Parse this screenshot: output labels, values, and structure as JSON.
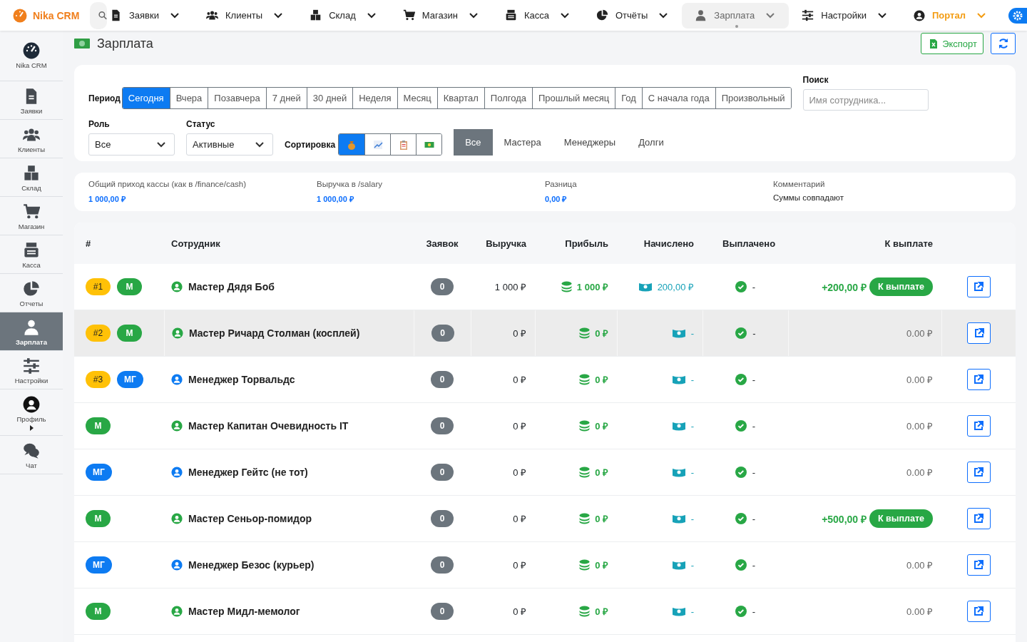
{
  "topbar": {
    "brand": "Nika CRM",
    "nav": [
      {
        "label": "Заявки",
        "selected": false
      },
      {
        "label": "Клиенты",
        "selected": false
      },
      {
        "label": "Склад",
        "selected": false
      },
      {
        "label": "Магазин",
        "selected": false
      },
      {
        "label": "Касса",
        "selected": false
      },
      {
        "label": "Отчёты",
        "selected": false
      },
      {
        "label": "Зарплата",
        "selected": true
      },
      {
        "label": "Настройки",
        "selected": false
      },
      {
        "label": "Портал",
        "selected": false
      }
    ]
  },
  "sidebar": {
    "items": [
      {
        "label": "Nika CRM",
        "selected": false
      },
      {
        "label": "Заявки",
        "selected": false
      },
      {
        "label": "Клиенты",
        "selected": false
      },
      {
        "label": "Склад",
        "selected": false
      },
      {
        "label": "Магазин",
        "selected": false
      },
      {
        "label": "Касса",
        "selected": false
      },
      {
        "label": "Отчеты",
        "selected": false
      },
      {
        "label": "Зарплата",
        "selected": true
      },
      {
        "label": "Настройки",
        "selected": false
      },
      {
        "label": "Профиль",
        "selected": false
      },
      {
        "label": "Чат",
        "selected": false
      }
    ]
  },
  "page": {
    "title": "Зарплата",
    "export_button": "Экспорт"
  },
  "filters": {
    "period_label": "Период",
    "periods": [
      {
        "label": "Сегодня",
        "selected": true
      },
      {
        "label": "Вчера",
        "selected": false
      },
      {
        "label": "Позавчера",
        "selected": false
      },
      {
        "label": "7 дней",
        "selected": false
      },
      {
        "label": "30 дней",
        "selected": false
      },
      {
        "label": "Неделя",
        "selected": false
      },
      {
        "label": "Месяц",
        "selected": false
      },
      {
        "label": "Квартал",
        "selected": false
      },
      {
        "label": "Полгода",
        "selected": false
      },
      {
        "label": "Прошлый месяц",
        "selected": false
      },
      {
        "label": "Год",
        "selected": false
      },
      {
        "label": "С начала года",
        "selected": false
      },
      {
        "label": "Произвольный",
        "selected": false
      }
    ],
    "search_label": "Поиск",
    "search": {
      "placeholder": "Имя сотрудника..."
    },
    "role_label": "Роль",
    "role_value": "Все",
    "status_label": "Статус",
    "status_value": "Активные",
    "sort_label": "Сортировка",
    "sort_options": [
      {
        "selected": true
      },
      {
        "selected": false
      },
      {
        "selected": false
      },
      {
        "selected": false
      }
    ],
    "groups": [
      {
        "label": "Все",
        "selected": true
      },
      {
        "label": "Мастера",
        "selected": false
      },
      {
        "label": "Менеджеры",
        "selected": false
      },
      {
        "label": "Долги",
        "selected": false
      }
    ]
  },
  "summary": [
    {
      "label": "Общий приход кассы (как в /finance/cash)",
      "value": "1 000,00 ₽",
      "kind": "money"
    },
    {
      "label": "Выручка в /salary",
      "value": "1 000,00 ₽",
      "kind": "money"
    },
    {
      "label": "Разница",
      "value": "0,00 ₽",
      "kind": "money"
    },
    {
      "label": "Комментарий",
      "value": "Суммы совпадают",
      "kind": "note"
    }
  ],
  "table": {
    "columns": [
      "#",
      "Сотрудник",
      "Заявок",
      "Выручка",
      "Прибыль",
      "Начислено",
      "Выплачено",
      "К выплате"
    ],
    "rows": [
      {
        "rank": "#1",
        "role": "М",
        "color": "#28a745",
        "name": "Мастер Дядя Боб",
        "orders": "0",
        "revenue": "1 000 ₽",
        "profit": "1 000 ₽",
        "accrued": "200,00 ₽",
        "paid": "-",
        "to_pay": "+200,00 ₽",
        "kind": "due",
        "pay_button": "К выплате",
        "selected": false
      },
      {
        "rank": "#2",
        "role": "М",
        "color": "#28a745",
        "name": "Мастер Ричард Столман (косплей)",
        "orders": "0",
        "revenue": "0 ₽",
        "profit": "0 ₽",
        "accrued": "-",
        "paid": "-",
        "to_pay": "0.00 ₽",
        "kind": "zero",
        "selected": true
      },
      {
        "rank": "#3",
        "role": "МГ",
        "color": "#0d7bf2",
        "name": "Менеджер Торвальдс",
        "orders": "0",
        "revenue": "0 ₽",
        "profit": "0 ₽",
        "accrued": "-",
        "paid": "-",
        "to_pay": "0.00 ₽",
        "kind": "zero",
        "selected": false
      },
      {
        "role": "М",
        "color": "#28a745",
        "name": "Мастер Капитан Очевидность IT",
        "orders": "0",
        "revenue": "0 ₽",
        "profit": "0 ₽",
        "accrued": "-",
        "paid": "-",
        "to_pay": "0.00 ₽",
        "kind": "zero",
        "selected": false
      },
      {
        "role": "МГ",
        "color": "#0d7bf2",
        "name": "Менеджер Гейтс (не тот)",
        "orders": "0",
        "revenue": "0 ₽",
        "profit": "0 ₽",
        "accrued": "-",
        "paid": "-",
        "to_pay": "0.00 ₽",
        "kind": "zero",
        "selected": false
      },
      {
        "role": "М",
        "color": "#28a745",
        "name": "Мастер Сеньор-помидор",
        "orders": "0",
        "revenue": "0 ₽",
        "profit": "0 ₽",
        "accrued": "-",
        "paid": "-",
        "to_pay": "+500,00 ₽",
        "kind": "due",
        "pay_button": "К выплате",
        "selected": false
      },
      {
        "role": "МГ",
        "color": "#0d7bf2",
        "name": "Менеджер Безос (курьер)",
        "orders": "0",
        "revenue": "0 ₽",
        "profit": "0 ₽",
        "accrued": "-",
        "paid": "-",
        "to_pay": "0.00 ₽",
        "kind": "zero",
        "selected": false
      },
      {
        "role": "М",
        "color": "#28a745",
        "name": "Мастер Мидл-мемолог",
        "orders": "0",
        "revenue": "0 ₽",
        "profit": "0 ₽",
        "accrued": "-",
        "paid": "-",
        "to_pay": "0.00 ₽",
        "kind": "zero",
        "selected": false
      }
    ]
  }
}
